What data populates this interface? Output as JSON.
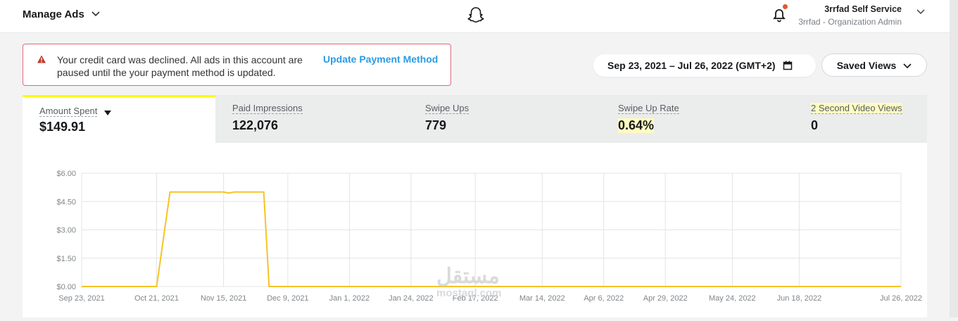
{
  "header": {
    "app_title": "Manage Ads",
    "user_name": "3rrfad Self Service",
    "user_role": "3rrfad - Organization Admin"
  },
  "alert": {
    "message": "Your credit card was declined. All ads in this account are paused until the your payment method is updated.",
    "action_label": "Update Payment Method"
  },
  "date_range": "Sep 23, 2021 – Jul 26, 2022 (GMT+2)",
  "saved_views_label": "Saved Views",
  "metrics": [
    {
      "label": "Amount Spent",
      "value": "$149.91",
      "active": true
    },
    {
      "label": "Paid Impressions",
      "value": "122,076"
    },
    {
      "label": "Swipe Ups",
      "value": "779"
    },
    {
      "label": "Swipe Up Rate",
      "value": "0.64%"
    },
    {
      "label": "2 Second Video Views",
      "value": "0"
    }
  ],
  "icons": [
    "chevron-down-icon",
    "snapchat-ghost-icon",
    "bell-icon",
    "warning-icon",
    "calendar-icon"
  ],
  "colors": {
    "accent_yellow": "#fffc00",
    "line": "#f7c325",
    "link": "#2b9be5",
    "alert_border": "#e0677a",
    "notification": "#e4572e"
  },
  "chart_data": {
    "type": "line",
    "x": [
      "Sep 23, 2021",
      "Oct 21, 2021",
      "Oct 26, 2021",
      "Nov 12, 2021",
      "Nov 15, 2021",
      "Nov 17, 2021",
      "Nov 19, 2021",
      "Nov 30, 2021",
      "Dec 2, 2021",
      "Jul 26, 2022"
    ],
    "series": [
      {
        "values": [
          0,
          0,
          5.0,
          5.0,
          5.0,
          4.95,
          5.0,
          5.0,
          0,
          0
        ]
      }
    ],
    "yticks": [
      "$0.00",
      "$1.50",
      "$3.00",
      "$4.50",
      "$6.00"
    ],
    "xticks": [
      "Sep 23, 2021",
      "Oct 21, 2021",
      "Nov 15, 2021",
      "Dec 9, 2021",
      "Jan 1, 2022",
      "Jan 24, 2022",
      "Feb 17, 2022",
      "Mar 14, 2022",
      "Apr 6, 2022",
      "Apr 29, 2022",
      "May 24, 2022",
      "Jun 18, 2022",
      "Jul 26, 2022"
    ],
    "ylim": [
      0,
      6
    ],
    "grid": true
  },
  "watermark": {
    "arabic": "مستقل",
    "latin": "mostaql.com"
  }
}
